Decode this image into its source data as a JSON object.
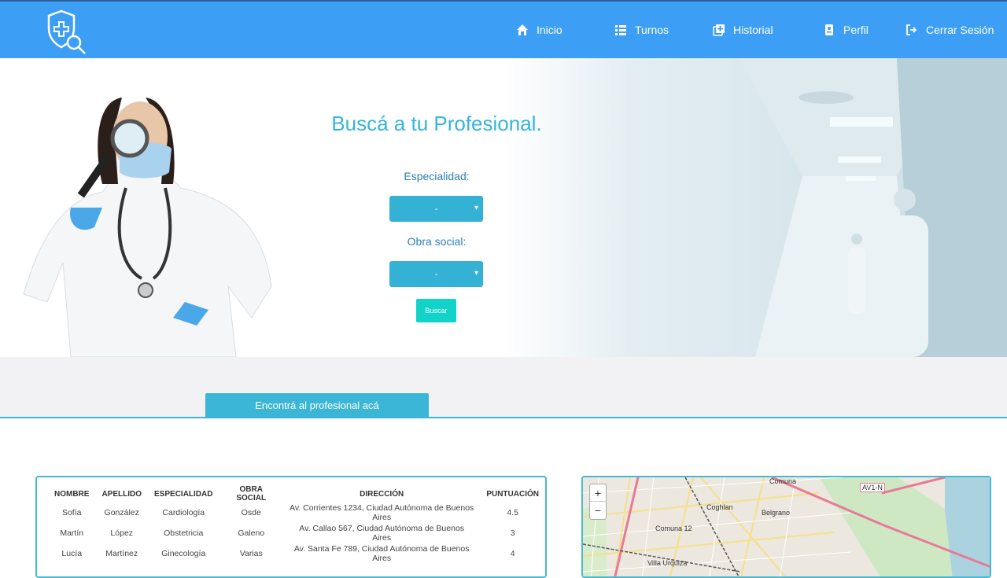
{
  "nav": {
    "items": [
      {
        "label": "Inicio",
        "icon": "home-icon"
      },
      {
        "label": "Turnos",
        "icon": "list-icon"
      },
      {
        "label": "Historial",
        "icon": "history-icon"
      },
      {
        "label": "Perfil",
        "icon": "id-card-icon"
      },
      {
        "label": "Cerrar Sesión",
        "icon": "logout-icon"
      }
    ],
    "logo_icon": "shield-search-icon"
  },
  "hero": {
    "title": "Buscá a tu Profesional.",
    "especialidad_label": "Especialidad:",
    "especialidad_value": "-",
    "obra_social_label": "Obra social:",
    "obra_social_value": "-",
    "buscar_label": "Buscar"
  },
  "tab": {
    "label": "Encontrá al profesional acá"
  },
  "table": {
    "headers": [
      "NOMBRE",
      "APELLIDO",
      "ESPECIALIDAD",
      "OBRA SOCIAL",
      "DIRECCIÓN",
      "PUNTUACIÓN"
    ],
    "rows": [
      [
        "Sofía",
        "González",
        "Cardiología",
        "Osde",
        "Av. Corrientes 1234, Ciudad Autónoma de Buenos Aires",
        "4.5"
      ],
      [
        "Martín",
        "López",
        "Obstetricia",
        "Galeno",
        "Av. Callao 567, Ciudad Autónoma de Buenos Aires",
        "3"
      ],
      [
        "Lucía",
        "Martínez",
        "Ginecología",
        "Varias",
        "Av. Santa Fe 789, Ciudad Autónoma de Buenos Aires",
        "4"
      ]
    ]
  },
  "map": {
    "zoom_in": "+",
    "zoom_out": "−",
    "labels": [
      "Coghlan",
      "Belgrano",
      "Comuna 12",
      "Villa Urquiza",
      "Comuna",
      "AV1-N",
      "Comuna"
    ]
  },
  "colors": {
    "navbar": "#3d9ef5",
    "accent": "#34b5dd",
    "button": "#12d3c9"
  }
}
